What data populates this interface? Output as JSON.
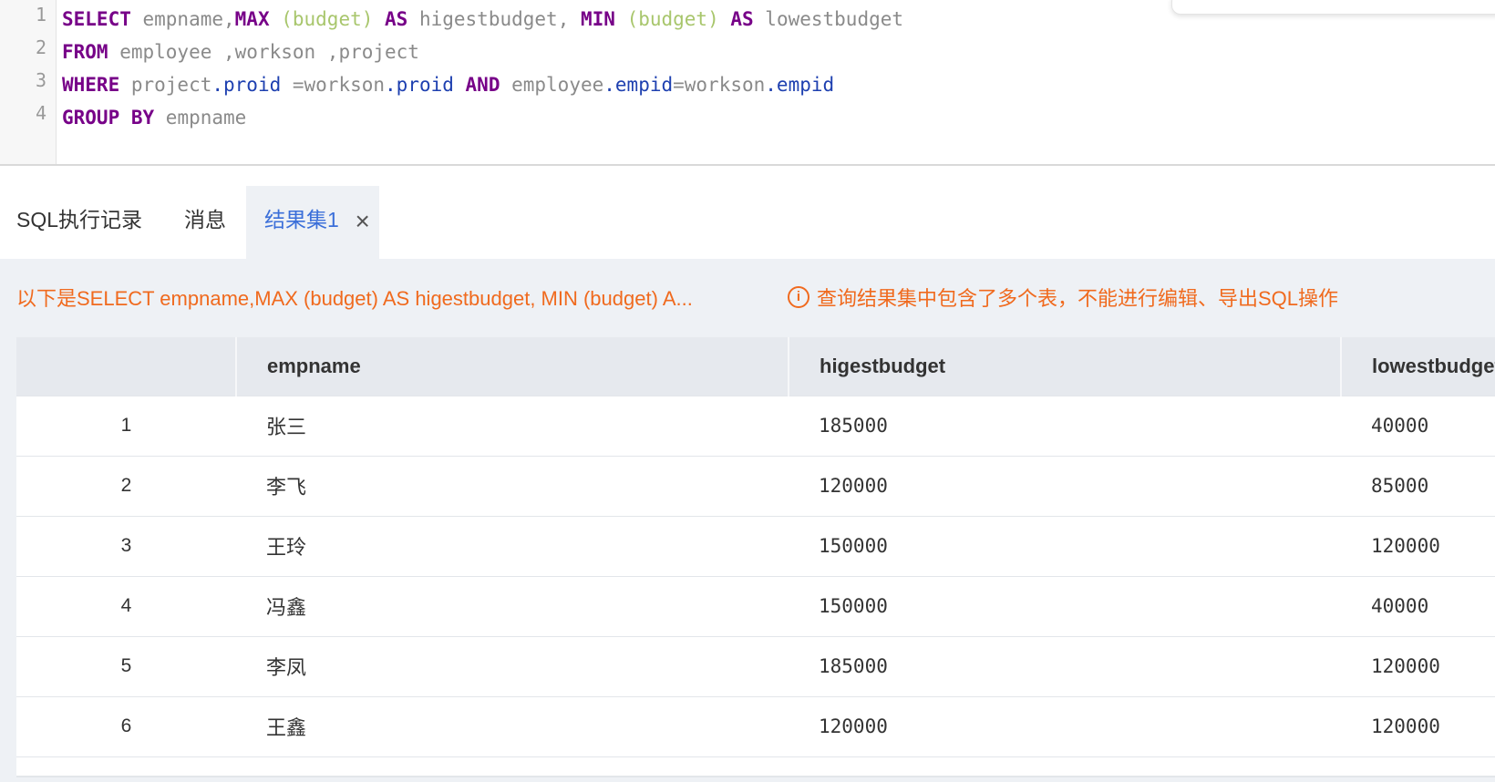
{
  "editor": {
    "line_numbers": [
      "1",
      "2",
      "3",
      "4"
    ],
    "lines": [
      [
        {
          "t": "SELECT",
          "c": "kw"
        },
        {
          "t": " empname,",
          "c": "ident"
        },
        {
          "t": "MAX",
          "c": "kw"
        },
        {
          "t": " (budget)",
          "c": "par"
        },
        {
          "t": " AS",
          "c": "kw"
        },
        {
          "t": " higestbudget,",
          "c": "ident"
        },
        {
          "t": " MIN",
          "c": "kw"
        },
        {
          "t": " (budget)",
          "c": "par"
        },
        {
          "t": " AS",
          "c": "kw"
        },
        {
          "t": " lowestbudget",
          "c": "ident"
        }
      ],
      [
        {
          "t": "FROM",
          "c": "kw"
        },
        {
          "t": " employee ,workson ,project",
          "c": "ident"
        }
      ],
      [
        {
          "t": "WHERE",
          "c": "kw"
        },
        {
          "t": " project",
          "c": "ident"
        },
        {
          "t": ".proid",
          "c": "prop"
        },
        {
          "t": " =workson",
          "c": "ident"
        },
        {
          "t": ".proid",
          "c": "prop"
        },
        {
          "t": " AND",
          "c": "kw"
        },
        {
          "t": " employee",
          "c": "ident"
        },
        {
          "t": ".empid",
          "c": "prop"
        },
        {
          "t": "=workson",
          "c": "ident"
        },
        {
          "t": ".empid",
          "c": "prop"
        }
      ],
      [
        {
          "t": "GROUP BY",
          "c": "kw"
        },
        {
          "t": " empname",
          "c": "ident"
        }
      ]
    ]
  },
  "tabs": {
    "history": "SQL执行记录",
    "messages": "消息",
    "result": "结果集1",
    "close_glyph": "×"
  },
  "result": {
    "notice": "以下是SELECT empname,MAX (budget) AS higestbudget, MIN (budget) A...",
    "warning_icon": "i",
    "warning": "查询结果集中包含了多个表，不能进行编辑、导出SQL操作",
    "columns": [
      "",
      "empname",
      "higestbudget",
      "lowestbudget"
    ],
    "rows": [
      [
        "1",
        "张三",
        "185000",
        "40000"
      ],
      [
        "2",
        "李飞",
        "120000",
        "85000"
      ],
      [
        "3",
        "王玲",
        "150000",
        "120000"
      ],
      [
        "4",
        "冯鑫",
        "150000",
        "40000"
      ],
      [
        "5",
        "李凤",
        "185000",
        "120000"
      ],
      [
        "6",
        "王鑫",
        "120000",
        "120000"
      ]
    ]
  },
  "colors": {
    "keyword": "#770088",
    "accent_tab": "#3b6fd9",
    "warning": "#f06a1e"
  }
}
